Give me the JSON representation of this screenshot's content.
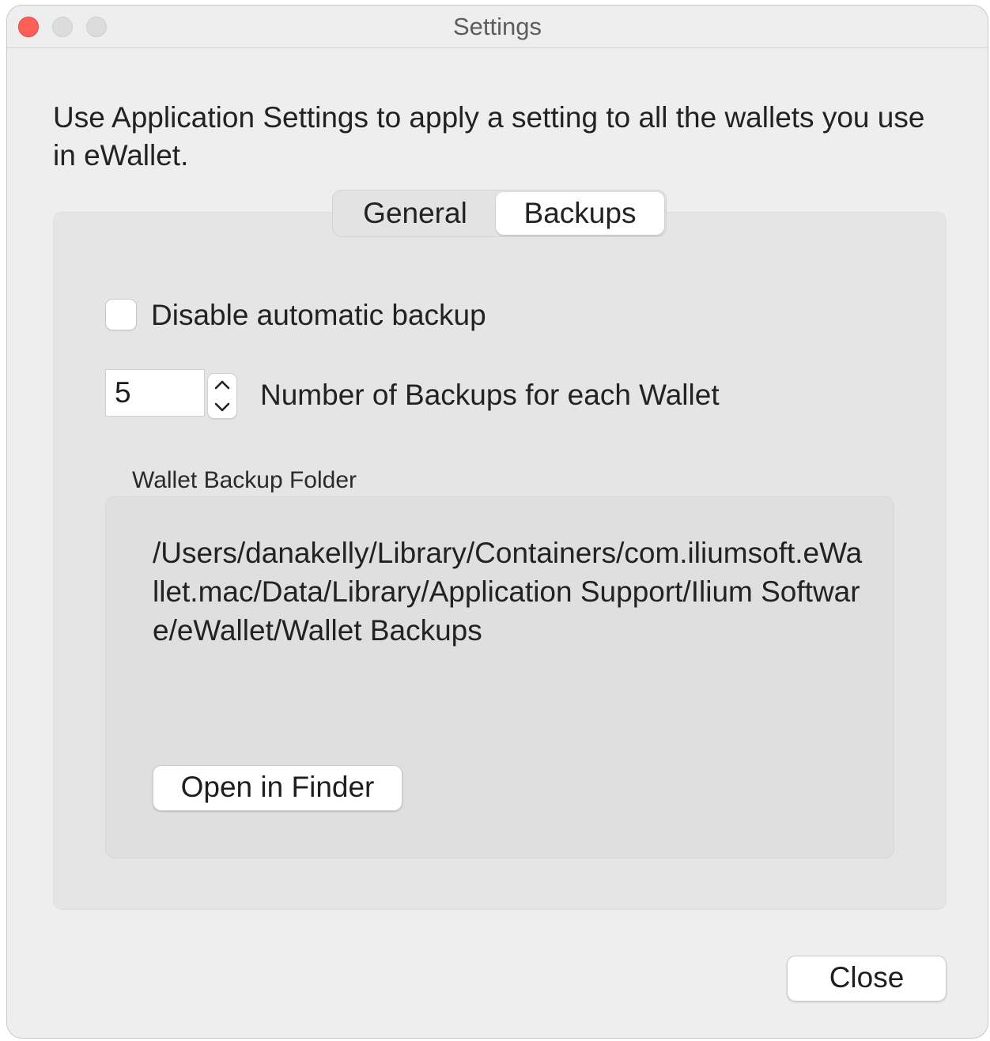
{
  "window": {
    "title": "Settings"
  },
  "intro": {
    "text": "Use Application Settings to apply a setting to all the wallets you use in eWallet."
  },
  "tabs": [
    {
      "label": "General",
      "selected": false
    },
    {
      "label": "Backups",
      "selected": true
    }
  ],
  "backups": {
    "disable_automatic_backup": {
      "label": "Disable automatic backup",
      "checked": false
    },
    "number_of_backups": {
      "value": "5",
      "label": "Number of Backups for each Wallet"
    },
    "folder_group": {
      "label": "Wallet Backup Folder",
      "path": "/Users/danakelly/Library/Containers/com.iliumsoft.eWallet.mac/Data/Library/Application Support/Ilium Software/eWallet/Wallet Backups",
      "open_button": "Open in Finder"
    }
  },
  "footer": {
    "close_button": "Close"
  },
  "icons": {
    "close": "close-window-icon",
    "minimize": "minimize-window-icon",
    "zoom": "zoom-window-icon",
    "stepper_up": "chevron-up-icon",
    "stepper_down": "chevron-down-icon"
  },
  "colors": {
    "window_background": "#efeeee",
    "tab_panel_background": "#e6e5e5",
    "close_light": "#fe5f57"
  }
}
